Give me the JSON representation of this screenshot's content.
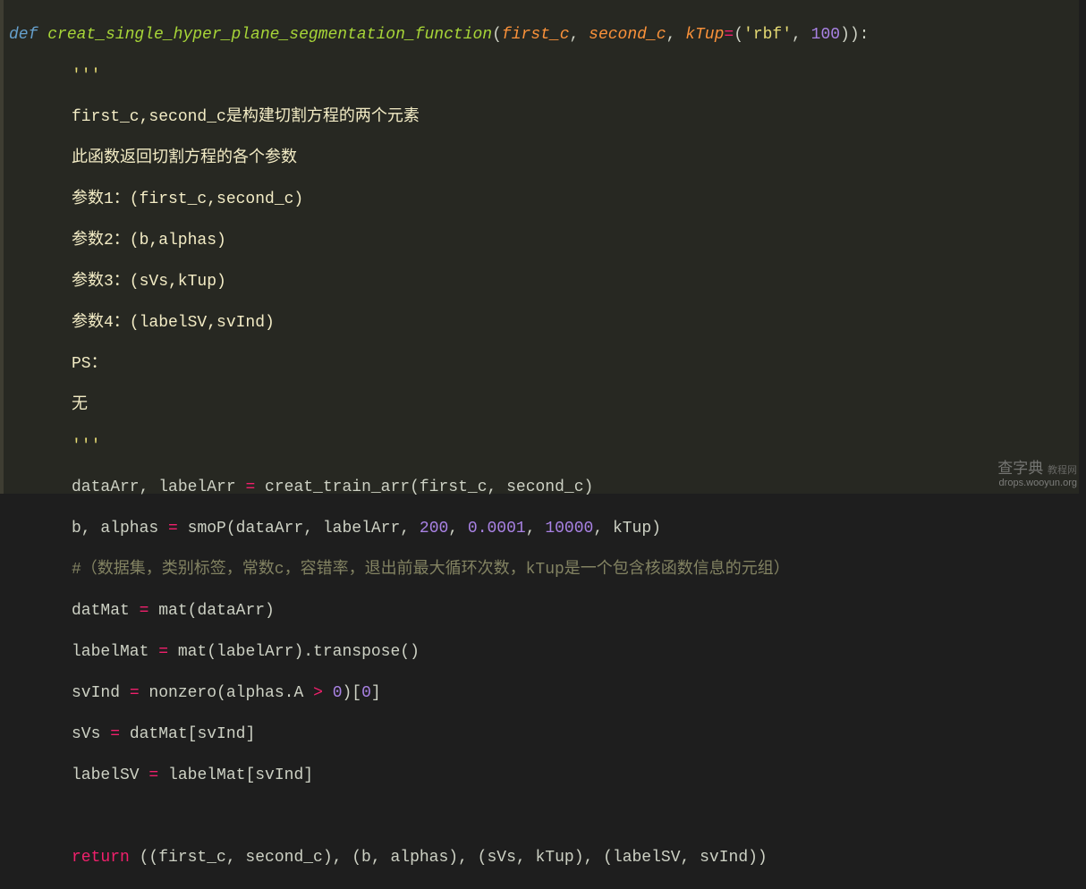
{
  "code": {
    "def": "def",
    "funcName": "creat_single_hyper_plane_segmentation_function",
    "params": {
      "p1": "first_c",
      "comma": ", ",
      "p2": "second_c",
      "p3": "kTup",
      "eq": "="
    },
    "defaultTuple": {
      "open": "(",
      "s": "'rbf'",
      "c": ", ",
      "n": "100",
      "close": ")"
    },
    "sigClose": "):",
    "docOpen": "'''",
    "doc1": "first_c,second_c是构建切割方程的两个元素",
    "doc2": "此函数返回切割方程的各个参数",
    "doc3": "参数1：(first_c,second_c)",
    "doc4": "参数2：(b,alphas)",
    "doc5": "参数3：(sVs,kTup)",
    "doc6": "参数4：(labelSV,svInd)",
    "doc7": "PS：",
    "doc8": "无",
    "docClose": "'''",
    "l1a": "dataArr, labelArr ",
    "l1op": "=",
    "l1b": " creat_train_arr(first_c, second_c)",
    "l2a": "b, alphas ",
    "l2op": "=",
    "l2b": " smoP(dataArr, labelArr, ",
    "l2n1": "200",
    "l2c1": ", ",
    "l2n2": "0.0001",
    "l2c2": ", ",
    "l2n3": "10000",
    "l2c3": ", kTup)",
    "comment": "#（数据集，类别标签，常数c，容错率，退出前最大循环次数，kTup是一个包含核函数信息的元组）",
    "l3a": "datMat ",
    "l3op": "=",
    "l3b": " mat(dataArr)",
    "l4a": "labelMat ",
    "l4op": "=",
    "l4b": " mat(labelArr).transpose()",
    "l5a": "svInd ",
    "l5op": "=",
    "l5b": " nonzero(alphas.A ",
    "l5gt": ">",
    "l5sp": " ",
    "l5n": "0",
    "l5c": ")[",
    "l5n2": "0",
    "l5d": "]",
    "l6a": "sVs ",
    "l6op": "=",
    "l6b": " datMat[svInd]",
    "l7a": "labelSV ",
    "l7op": "=",
    "l7b": " labelMat[svInd]",
    "ret": "return",
    "retExpr": " ((first_c, second_c), (b, alphas), (sVs, kTup), (labelSV, svInd))"
  },
  "watermark": {
    "site": "查字典",
    "sub": "教程网",
    "url": "drops.wooyun.org"
  }
}
